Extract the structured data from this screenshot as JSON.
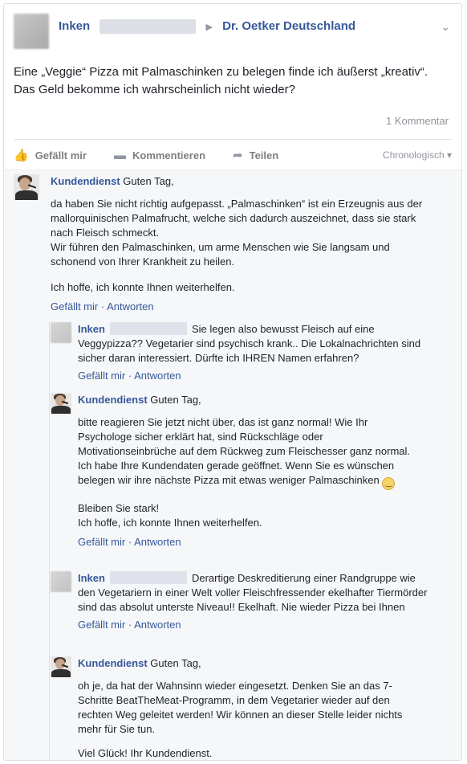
{
  "post": {
    "author": "Inken",
    "target": "Dr. Oetker Deutschland",
    "text": "Eine „Veggie“ Pizza mit Palmaschinken zu belegen finde ich äußerst „kreativ“. Das Geld bekomme ich wahrscheinlich nicht wieder?",
    "comment_count": "1 Kommentar"
  },
  "actions": {
    "like": "Gefällt mir",
    "comment": "Kommentieren",
    "share": "Teilen",
    "sort": "Chronologisch ▾"
  },
  "comments": [
    {
      "name": "Kundendienst",
      "lead": "Guten Tag,",
      "p1": "da haben Sie nicht richtig aufgepasst. „Palmaschinken“ ist ein Erzeugnis aus der mallorquinischen Palmafrucht, welche sich dadurch auszeichnet, dass sie stark nach Fleisch schmeckt.",
      "p1b": "Wir führen den Palmaschinken, um arme Menschen wie Sie langsam und schonend von Ihrer Krankheit zu heilen.",
      "p2": "Ich hoffe, ich konnte Ihnen weiterhelfen.",
      "like": "Gefällt mir",
      "sep": " · ",
      "reply": "Antworten"
    }
  ],
  "replies": [
    {
      "name": "Inken",
      "text": "Sie legen also bewusst Fleisch auf eine Veggypizza?? Vegetarier sind psychisch krank.. Die Lokalnachrichten sind sicher daran interessiert. Dürfte ich IHREN Namen erfahren?",
      "like": "Gefällt mir",
      "sep": " · ",
      "reply": "Antworten"
    },
    {
      "name": "Kundendienst",
      "lead": "Guten Tag,",
      "p1": "bitte reagieren Sie jetzt nicht über, das ist ganz normal! Wie Ihr Psychologe sicher erklärt hat, sind Rückschläge oder Motivationseinbrüche auf dem Rückweg zum Fleischesser ganz normal. Ich habe Ihre Kundendaten gerade geöffnet. Wenn Sie es wünschen belegen wir ihre nächste Pizza mit etwas weniger Palmaschinken",
      "p2a": "Bleiben Sie stark!",
      "p2b": "Ich hoffe, ich konnte Ihnen weiterhelfen.",
      "like": "Gefällt mir",
      "sep": " · ",
      "reply": "Antworten"
    },
    {
      "name": "Inken",
      "text": "Derartige Deskreditierung einer Randgruppe wie den Vegetariern in einer Welt voller Fleischfressender ekelhafter Tiermörder sind das absolut unterste Niveau!! Ekelhaft. Nie wieder Pizza bei Ihnen",
      "like": "Gefällt mir",
      "sep": " · ",
      "reply": "Antworten"
    },
    {
      "name": "Kundendienst",
      "lead": "Guten Tag,",
      "p1": "oh je, da hat der Wahnsinn wieder eingesetzt. Denken Sie an das 7-Schritte BeatTheMeat-Programm, in dem Vegetarier wieder auf den rechten Weg geleitet werden! Wir können an dieser Stelle leider nichts mehr für Sie tun.",
      "p2": "Viel Glück! Ihr Kundendienst."
    }
  ],
  "colors": {
    "link": "#365899",
    "muted": "#90949c",
    "comments_bg": "#f6f7f9"
  }
}
